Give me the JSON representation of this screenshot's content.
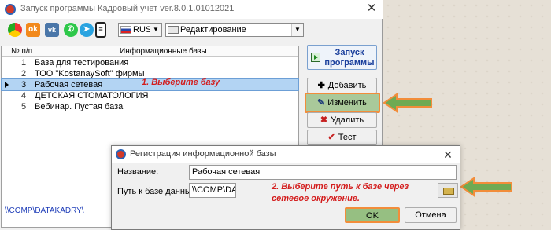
{
  "window": {
    "title": "Запуск программы Кадровый учет ver.8.0.1.01012021",
    "close_glyph": "✕"
  },
  "toolbar": {
    "icons": [
      "chrome-icon",
      "odnoklassniki-icon",
      "vk-icon",
      "whatsapp-icon",
      "telegram-icon",
      "database-icon"
    ],
    "language": "RUS",
    "mode": "Редактирование",
    "dropdown_glyph": "▼"
  },
  "list": {
    "col_num": "№ п/п",
    "col_name": "Информационные базы",
    "selected_index": 2,
    "rows": [
      {
        "num": "1",
        "name": "База для тестирования"
      },
      {
        "num": "2",
        "name": "ТОО \"KostanaySoft\" фирмы"
      },
      {
        "num": "3",
        "name": "Рабочая сетевая"
      },
      {
        "num": "4",
        "name": "ДЕТСКАЯ СТОМАТОЛОГИЯ"
      },
      {
        "num": "5",
        "name": "Вебинар. Пустая база"
      }
    ],
    "path": "\\\\COMP\\DATAKADRY\\"
  },
  "annotations": {
    "step1": "1. Выберите базу",
    "step2_line1": "2. Выберите путь к базе через",
    "step2_line2": "сетевое окружение."
  },
  "buttons": {
    "launch_line1": "Запуск",
    "launch_line2": "программы",
    "add": "Добавить",
    "add_icon": "✚",
    "edit": "Изменить",
    "edit_icon": "✎",
    "delete": "Удалить",
    "delete_icon": "✖",
    "test": "Тест",
    "test_icon": "✔"
  },
  "dialog": {
    "title": "Регистрация информационной базы",
    "close_glyph": "✕",
    "name_label": "Название:",
    "name_value": "Рабочая сетевая",
    "path_label": "Путь к базе данных:",
    "path_value": "\\\\COMP\\DATAKADRY\\",
    "ok": "OK",
    "cancel": "Отмена"
  },
  "colors": {
    "highlight_green": "#6faa53",
    "highlight_border": "#f28d3a",
    "annotation_red": "#d31b1b",
    "selected_row": "#b3d4f3"
  }
}
